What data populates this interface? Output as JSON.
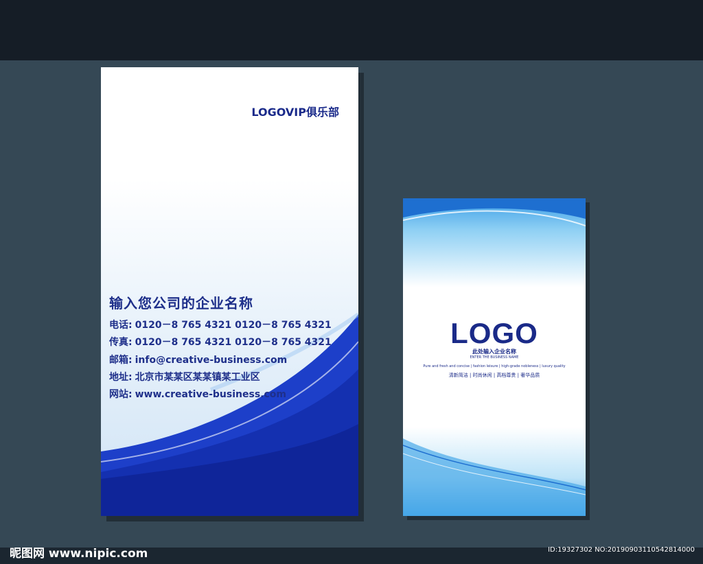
{
  "left_card": {
    "brand": "LOGOVIP俱乐部",
    "company": "输入您公司的企业名称",
    "lines": [
      {
        "key": "电话:",
        "value": "0120－8 765 4321 0120－8 765 4321"
      },
      {
        "key": "传真:",
        "value": "0120－8 765 4321 0120－8 765 4321"
      },
      {
        "key": "邮箱:",
        "value": "info@creative-business.com"
      },
      {
        "key": "地址:",
        "value": "北京市某某区某某镇某工业区"
      },
      {
        "key": "网站:",
        "value": "www.creative-business.com"
      }
    ]
  },
  "right_card": {
    "logo": "LOGO",
    "sub": "此处输入企业名称",
    "en": "ENTER THE BUSINESS NAME",
    "slogan_en": "Pure and fresh and concise  |  fashion leisure  |  high-grade nobleness  |  luxury quality",
    "slogan_cn": "清新简洁 | 时尚休闲 | 高档尊贵 | 奢华品质"
  },
  "watermark": {
    "left": "昵图网 www.nipic.com",
    "right": "ID:19327302 NO:20190903110542814000"
  },
  "colors": {
    "primary": "#1e2f8a",
    "wave": "#1a3cc8",
    "light_blue": "#3c9ee6"
  }
}
